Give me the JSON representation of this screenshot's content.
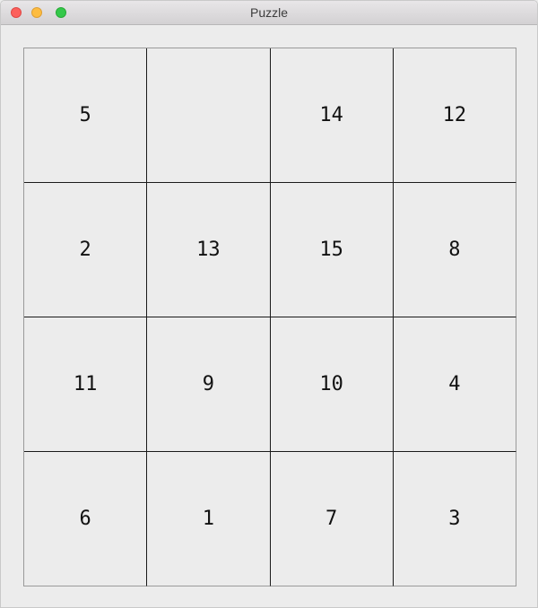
{
  "window": {
    "title": "Puzzle"
  },
  "board": {
    "rows": 4,
    "cols": 4,
    "tiles": [
      "5",
      "",
      "14",
      "12",
      "2",
      "13",
      "15",
      "8",
      "11",
      "9",
      "10",
      "4",
      "6",
      "1",
      "7",
      "3"
    ]
  }
}
